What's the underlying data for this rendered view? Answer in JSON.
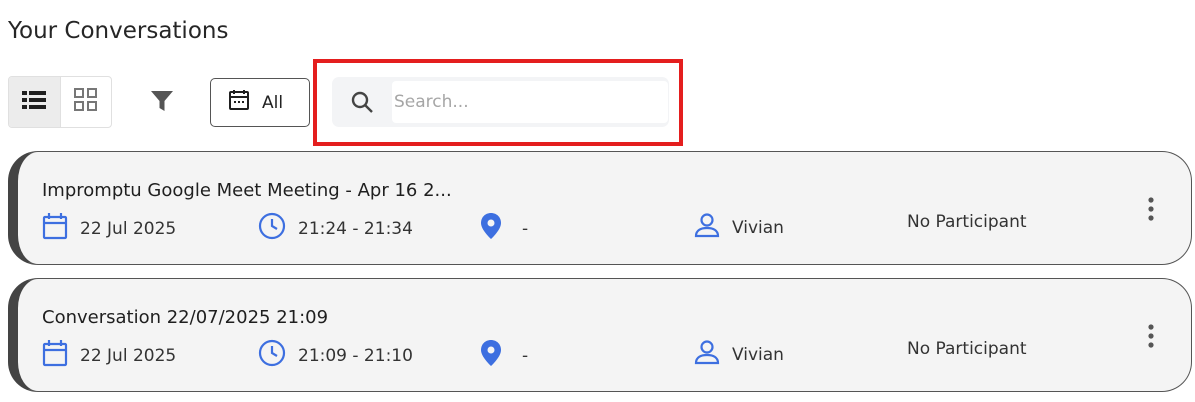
{
  "page": {
    "title": "Your Conversations"
  },
  "toolbar": {
    "date_filter_label": "All",
    "search_placeholder": "Search...",
    "search_value": ""
  },
  "conversations": [
    {
      "title": "Impromptu Google Meet Meeting - Apr 16 2...",
      "date": "22 Jul 2025",
      "time": "21:24 - 21:34",
      "location": "-",
      "owner": "Vivian",
      "participants": "No Participant"
    },
    {
      "title": "Conversation 22/07/2025 21:09",
      "date": "22 Jul 2025",
      "time": "21:09 - 21:10",
      "location": "-",
      "owner": "Vivian",
      "participants": "No Participant"
    }
  ],
  "colors": {
    "accent_blue": "#3d6fe0",
    "highlight_red": "#e41e1e",
    "card_bg": "#f4f4f4",
    "card_border": "#444444"
  },
  "icons": [
    "list-view-icon",
    "grid-view-icon",
    "filter-icon",
    "calendar-icon",
    "search-icon",
    "clock-icon",
    "location-pin-icon",
    "person-icon",
    "kebab-menu-icon"
  ]
}
